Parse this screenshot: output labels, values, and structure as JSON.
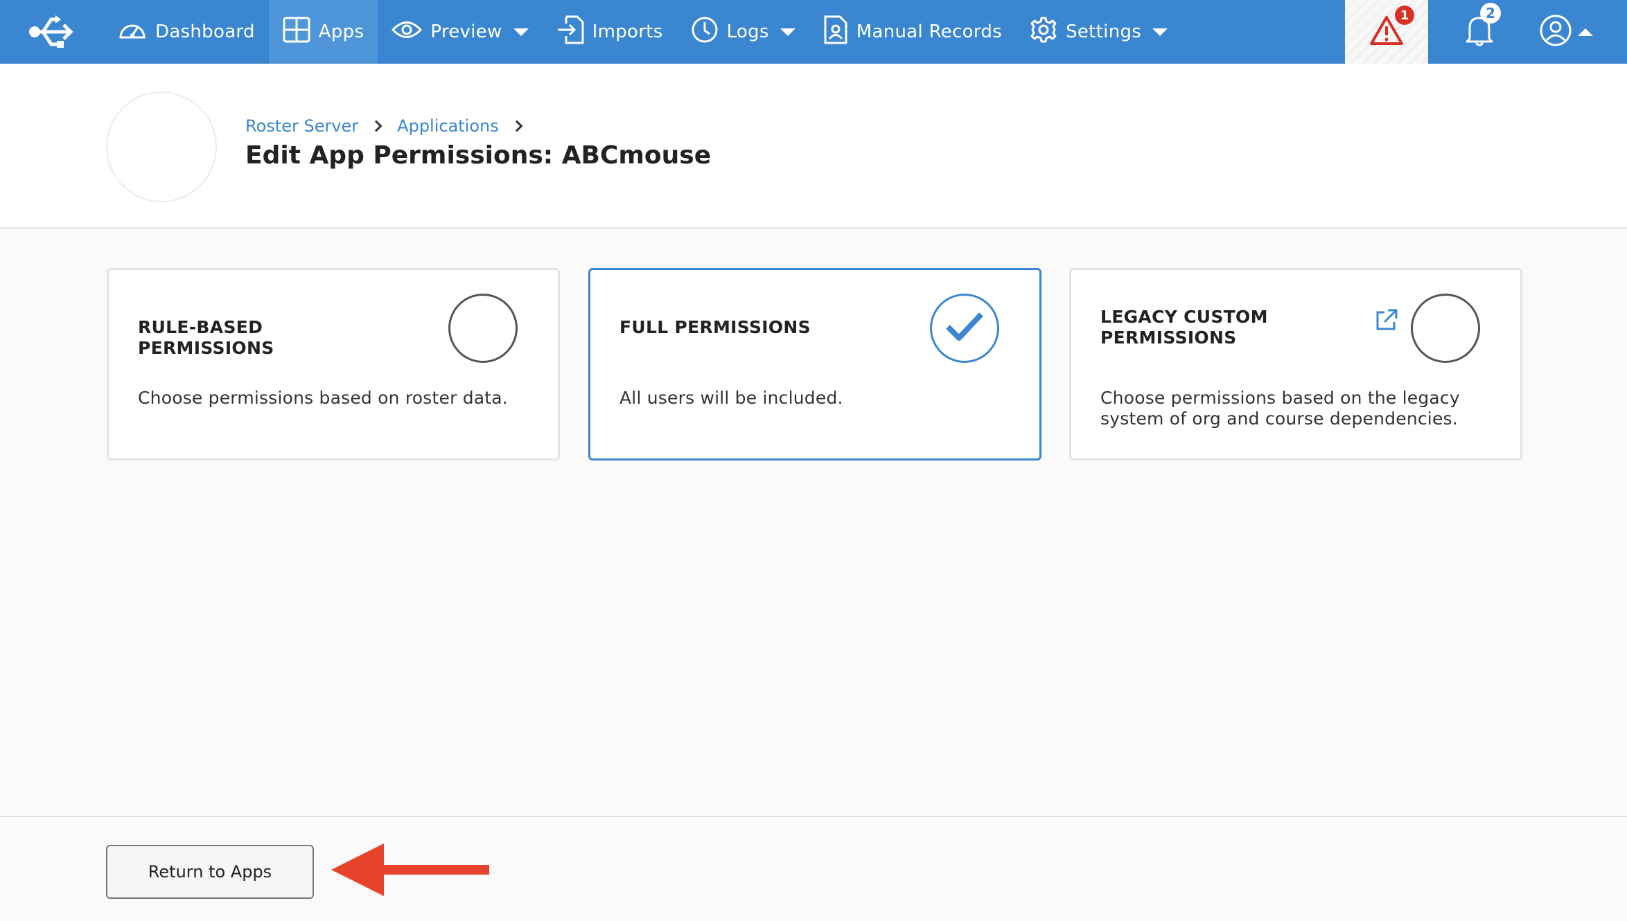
{
  "nav": {
    "items": [
      {
        "label": "Dashboard",
        "icon": "speedometer-icon",
        "active": false,
        "dropdown": false
      },
      {
        "label": "Apps",
        "icon": "grid-icon",
        "active": true,
        "dropdown": false
      },
      {
        "label": "Preview",
        "icon": "eye-icon",
        "active": false,
        "dropdown": true
      },
      {
        "label": "Imports",
        "icon": "import-icon",
        "active": false,
        "dropdown": false
      },
      {
        "label": "Logs",
        "icon": "clock-icon",
        "active": false,
        "dropdown": true
      },
      {
        "label": "Manual Records",
        "icon": "document-user-icon",
        "active": false,
        "dropdown": false
      },
      {
        "label": "Settings",
        "icon": "gear-icon",
        "active": false,
        "dropdown": true
      }
    ],
    "alert_count": "1",
    "notification_count": "2",
    "colors": {
      "bar": "#3b86d1",
      "active": "#4f95da",
      "alert_badge": "#d93025"
    }
  },
  "header": {
    "breadcrumbs": [
      "Roster Server",
      "Applications"
    ],
    "title": "Edit App Permissions: ABCmouse"
  },
  "permissions": [
    {
      "title": "RULE-BASED PERMISSIONS",
      "description": "Choose permissions based on roster data.",
      "selected": false
    },
    {
      "title": "FULL PERMISSIONS",
      "description": "All users will be included.",
      "selected": true
    },
    {
      "title": "LEGACY CUSTOM PERMISSIONS",
      "description": "Choose permissions based on the legacy system of org and course dependencies.",
      "selected": false,
      "icon": "external-link-icon"
    }
  ],
  "footer": {
    "return_label": "Return to Apps",
    "annotation_color": "#e8412c"
  }
}
